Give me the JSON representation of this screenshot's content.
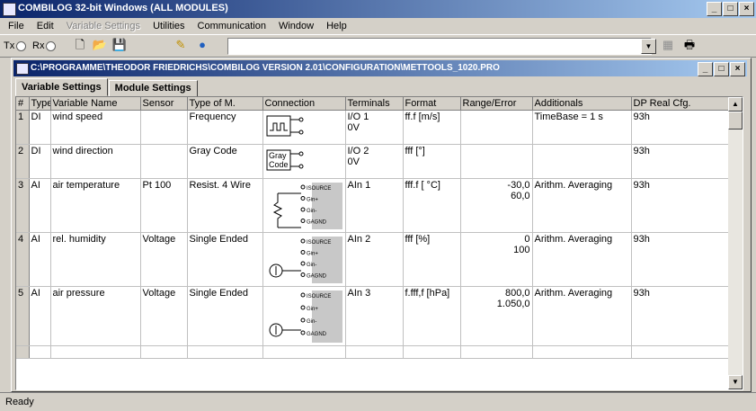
{
  "app": {
    "title": "COMBILOG 32-bit Windows (ALL MODULES)"
  },
  "menu": [
    "File",
    "Edit",
    "Variable Settings",
    "Utilities",
    "Communication",
    "Window",
    "Help"
  ],
  "toolbar": {
    "tx_label": "Tx",
    "rx_label": "Rx",
    "combo_value": ""
  },
  "child": {
    "title": "C:\\PROGRAMME\\THEODOR FRIEDRICHS\\COMBILOG VERSION 2.01\\CONFIGURATION\\METTOOLS_1020.PRO"
  },
  "tabs": [
    "Variable Settings",
    "Module Settings"
  ],
  "columns": [
    "#",
    "Type",
    "Variable Name",
    "Sensor",
    "Type of M.",
    "Connection",
    "Terminals",
    "Format",
    "Range/Error",
    "Additionals",
    "DP Real Cfg."
  ],
  "rows": [
    {
      "idx": "1",
      "type": "DI",
      "name": "wind speed",
      "sensor": "",
      "tom": "Frequency",
      "terminals": [
        "I/O 1",
        "0V"
      ],
      "format": "ff.f [m/s]",
      "range": [],
      "additionals": "TimeBase = 1 s",
      "dp": "93h",
      "conn": "square"
    },
    {
      "idx": "2",
      "type": "DI",
      "name": "wind direction",
      "sensor": "",
      "tom": "Gray Code",
      "terminals": [
        "I/O 2",
        "0V"
      ],
      "format": "fff [°]",
      "range": [],
      "additionals": "",
      "dp": "93h",
      "conn": "gray"
    },
    {
      "idx": "3",
      "type": "AI",
      "name": "air temperature",
      "sensor": "Pt 100",
      "tom": "Resist. 4 Wire",
      "terminals": [
        "AIn 1"
      ],
      "format": "fff.f [ °C]",
      "range": [
        "-30,0",
        "60,0"
      ],
      "additionals": "Arithm. Averaging",
      "dp": "93h",
      "conn": "resistor"
    },
    {
      "idx": "4",
      "type": "AI",
      "name": "rel. humidity",
      "sensor": "Voltage",
      "tom": "Single Ended",
      "terminals": [
        "AIn 2"
      ],
      "format": "fff [%]",
      "range": [
        "0",
        "100"
      ],
      "additionals": "Arithm. Averaging",
      "dp": "93h",
      "conn": "source"
    },
    {
      "idx": "5",
      "type": "AI",
      "name": "air pressure",
      "sensor": "Voltage",
      "tom": "Single Ended",
      "terminals": [
        "AIn 3"
      ],
      "format": "f.fff,f [hPa]",
      "range": [
        "800,0",
        "1.050,0"
      ],
      "additionals": "Arithm. Averaging",
      "dp": "93h",
      "conn": "source"
    }
  ],
  "conn_labels": {
    "gray_text": "Gray\nCode",
    "pins": [
      "ISOURCE",
      "Gin+",
      "Gin-",
      "GAGND"
    ]
  },
  "status": {
    "text": "Ready"
  }
}
